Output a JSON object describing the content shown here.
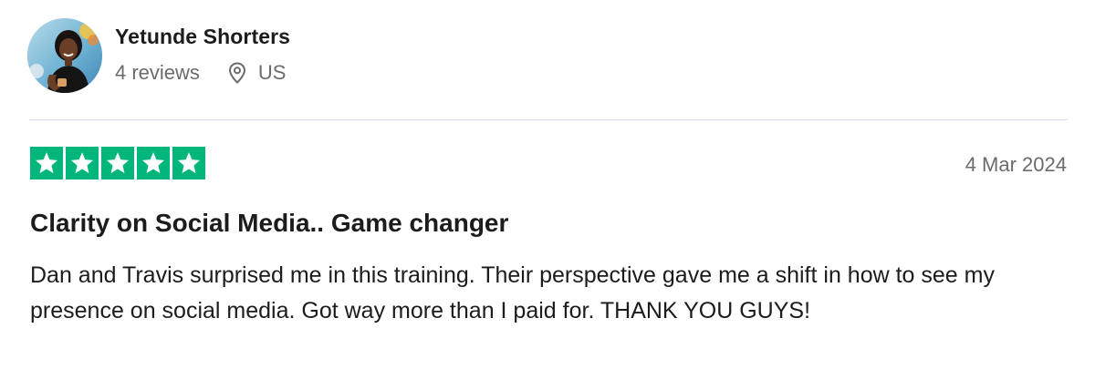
{
  "reviewer": {
    "name": "Yetunde Shorters",
    "reviews_count": "4 reviews",
    "country": "US",
    "avatar_icon": "user-avatar-photo",
    "location_icon": "location-pin-icon"
  },
  "review": {
    "rating": 5,
    "rating_max": 5,
    "star_color": "#00b67a",
    "date": "4 Mar 2024",
    "title": "Clarity on Social Media.. Game changer",
    "body": "Dan and Travis surprised me in this training. Their perspective gave me a shift in how to see my presence on social media. Got way more than I paid for. THANK YOU GUYS!"
  }
}
